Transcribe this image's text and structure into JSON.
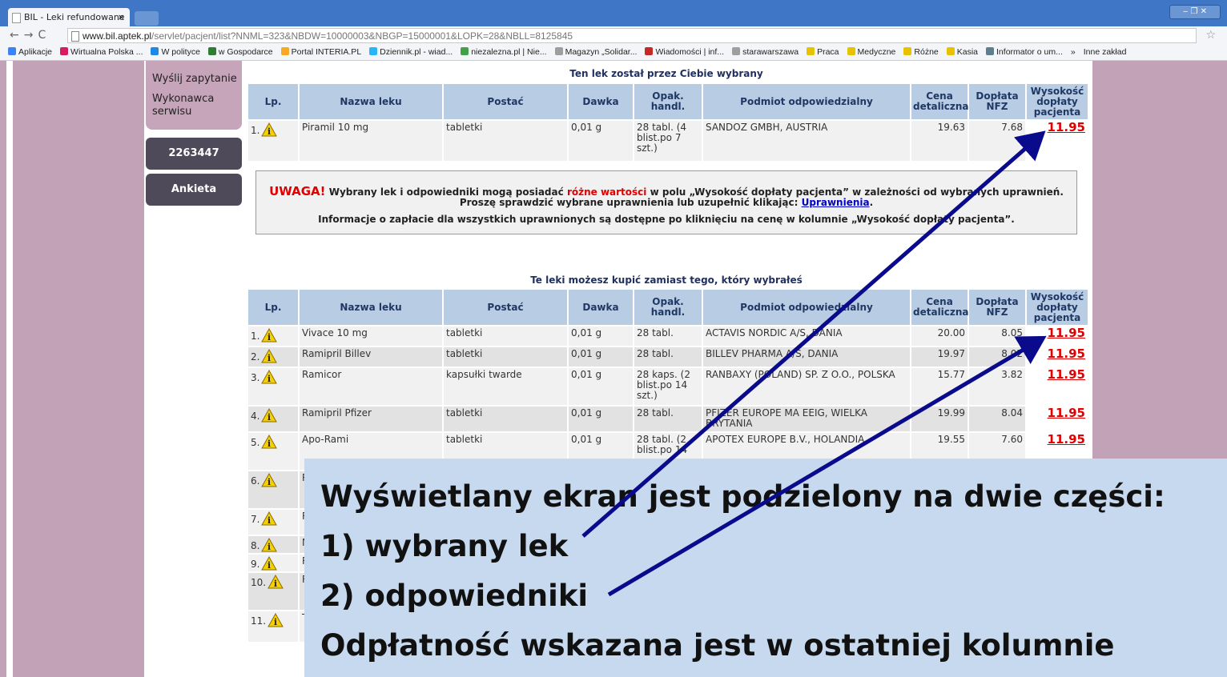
{
  "browser": {
    "tab_title": "BIL - Leki refundowane",
    "tab_close": "×",
    "url_host": "www.bil.aptek.pl",
    "url_rest": "/servlet/pacjent/list?NNML=323&NBDW=10000003&NBGP=15000001&LOPK=28&NBLL=8125845",
    "bookmarks": [
      "Aplikacje",
      "Wirtualna Polska ...",
      "W polityce",
      "w Gospodarce",
      "Portal INTERIA.PL",
      "Dziennik.pl - wiad...",
      "niezalezna.pl | Nie...",
      "Magazyn „Solidar...",
      "Wiadomości | inf...",
      "starawarszawa",
      "Praca",
      "Medyczne",
      "Różne",
      "Kasia",
      "Informator o um...",
      "»",
      "Inne zakład"
    ]
  },
  "sidebar": {
    "items": [
      "Wyślij zapytanie",
      "Wykonawca serwisu"
    ],
    "counter": "2263447",
    "survey": "Ankieta"
  },
  "selected": {
    "title": "Ten lek został przez Ciebie wybrany",
    "headers": [
      "Lp.",
      "Nazwa leku",
      "Postać",
      "Dawka",
      "Opak. handl.",
      "Podmiot odpowiedzialny",
      "Cena detaliczna",
      "Dopłata NFZ",
      "Wysokość dopłaty pacjenta"
    ],
    "rows": [
      {
        "lp": "1.",
        "name": "Piramil 10 mg",
        "form": "tabletki",
        "dose": "0,01 g",
        "pack": "28 tabl. (4 blist.po 7 szt.)",
        "company": "SANDOZ GMBH, AUSTRIA",
        "price": "19.63",
        "nfz": "7.68",
        "patient": "11.95"
      }
    ]
  },
  "notice": {
    "uwaga": "UWAGA!",
    "l1_a": "Wybrany lek i odpowiedniki mogą posiadać",
    "l1_red": "różne wartości",
    "l1_b": "w polu „Wysokość dopłaty pacjenta” w zależności od wybranych uprawnień.",
    "l2_a": "Proszę sprawdzić wybrane uprawnienia lub uzupełnić klikając:",
    "l2_link": "Uprawnienia",
    "l3": "Informacje o zapłacie dla wszystkich uprawnionych są dostępne po kliknięciu na cenę w kolumnie „Wysokość dopłaty pacjenta”."
  },
  "alternatives": {
    "title": "Te leki możesz kupić zamiast tego, który wybrałeś",
    "rows": [
      {
        "lp": "1.",
        "name": "Vivace 10 mg",
        "form": "tabletki",
        "dose": "0,01 g",
        "pack": "28 tabl.",
        "company": "ACTAVIS NORDIC A/S, DANIA",
        "price": "20.00",
        "nfz": "8.05",
        "patient": "11.95"
      },
      {
        "lp": "2.",
        "name": "Ramipril Billev",
        "form": "tabletki",
        "dose": "0,01 g",
        "pack": "28 tabl.",
        "company": "BILLEV PHARMA A/S, DANIA",
        "price": "19.97",
        "nfz": "8.02",
        "patient": "11.95"
      },
      {
        "lp": "3.",
        "name": "Ramicor",
        "form": "kapsułki twarde",
        "dose": "0,01 g",
        "pack": "28 kaps. (2 blist.po 14 szt.)",
        "company": "RANBAXY (POLAND) SP. Z O.O., POLSKA",
        "price": "15.77",
        "nfz": "3.82",
        "patient": "11.95"
      },
      {
        "lp": "4.",
        "name": "Ramipril Pfizer",
        "form": "tabletki",
        "dose": "0,01 g",
        "pack": "28 tabl.",
        "company": "PFIZER EUROPE MA EEIG, WIELKA BRYTANIA",
        "price": "19.99",
        "nfz": "8.04",
        "patient": "11.95"
      },
      {
        "lp": "5.",
        "name": "Apo-Rami",
        "form": "tabletki",
        "dose": "0,01 g",
        "pack": "28 tabl. (2 blist.po 14",
        "company": "APOTEX EUROPE B.V., HOLANDIA",
        "price": "19.55",
        "nfz": "7.60",
        "patient": "11.95"
      },
      {
        "lp": "6.",
        "name": "R",
        "form": "",
        "dose": "",
        "pack": "",
        "company": "",
        "price": "",
        "nfz": "",
        "patient": ""
      },
      {
        "lp": "7.",
        "name": "R",
        "form": "",
        "dose": "",
        "pack": "",
        "company": "",
        "price": "",
        "nfz": "",
        "patient": ""
      },
      {
        "lp": "8.",
        "name": "N",
        "form": "",
        "dose": "",
        "pack": "",
        "company": "",
        "price": "",
        "nfz": "",
        "patient": ""
      },
      {
        "lp": "9.",
        "name": "R",
        "form": "",
        "dose": "",
        "pack": "",
        "company": "",
        "price": "",
        "nfz": "",
        "patient": ""
      },
      {
        "lp": "10.",
        "name": "R",
        "form": "",
        "dose": "",
        "pack": "",
        "company": "",
        "price": "",
        "nfz": "",
        "patient": ""
      },
      {
        "lp": "11.",
        "name": "T",
        "form": "",
        "dose": "",
        "pack": "",
        "company": "",
        "price": "",
        "nfz": "",
        "patient": ""
      }
    ]
  },
  "overlay": {
    "lines": [
      "Wyświetlany ekran jest podzielony na dwie części:",
      "1) wybrany lek",
      "2) odpowiedniki",
      "Odpłatność wskazana jest w ostatniej kolumnie"
    ]
  },
  "colors": {
    "accent": "#b8cce4",
    "price_red": "#e00000",
    "overlay": "#c6d9ef",
    "arrow": "#0a0a8c"
  }
}
